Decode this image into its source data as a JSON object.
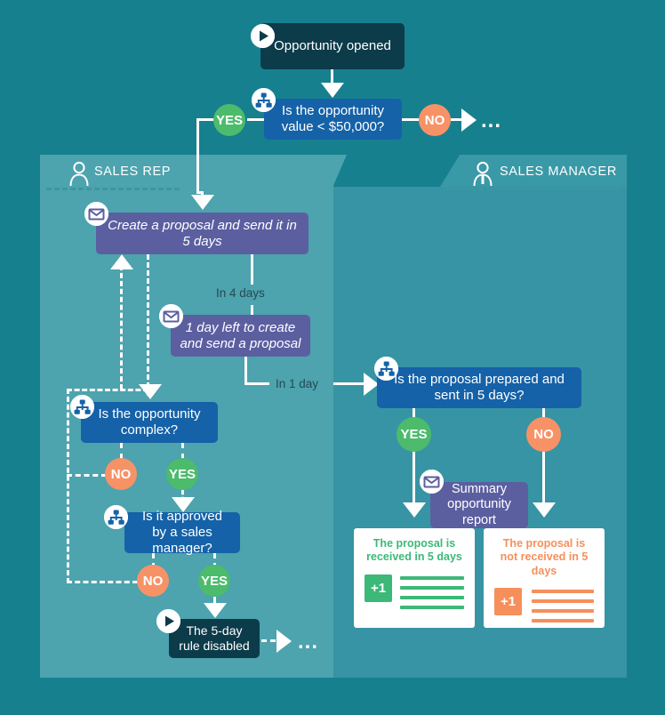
{
  "diagram": {
    "title_node": {
      "label": "Opportunity\nopened",
      "icon": "play-icon"
    },
    "lanes": [
      {
        "id": "sales-rep",
        "title": "SALES REP",
        "icon": "person-icon"
      },
      {
        "id": "sales-manager",
        "title": "SALES MANAGER",
        "icon": "person-icon"
      }
    ],
    "nodes": {
      "opportunity_opened": "Opportunity opened",
      "value_check": "Is the opportunity value < $50,000?",
      "create_proposal": "Create a proposal and send it in 5 days",
      "one_day_left": "1 day left to create and send a proposal",
      "opportunity_complex": "Is the opportunity complex?",
      "approved_by_manager": "Is it approved by a sales manager?",
      "rule_disabled": "The 5-day rule disabled",
      "proposal_prepared": "Is the proposal prepared and sent in 5 days?",
      "summary_report": "Summary opportunity report"
    },
    "branch_labels": {
      "yes": "YES",
      "no": "NO"
    },
    "time_labels": {
      "in_4_days": "In 4 days",
      "in_1_day": "In 1 day"
    },
    "ellipsis": "...",
    "result_cards": [
      {
        "title": "The proposal is received in 5 days",
        "counter": "+1",
        "color": "#3cb878",
        "bars": 4
      },
      {
        "title": "The proposal is not received in 5 days",
        "counter": "+1",
        "color": "#f68f5c",
        "bars": 4
      }
    ],
    "colors": {
      "background": "#17808f",
      "lane_rep": "#4da3ae",
      "lane_manager": "#3694a4",
      "node_dark": "#0c3b4a",
      "node_blue": "#1562a8",
      "node_purple": "#5b5fa0",
      "yes": "#4cbb6c",
      "no": "#f79267",
      "green_result": "#3cb878",
      "orange_result": "#f68f5c"
    },
    "icons": {
      "play": "play-icon",
      "branch": "branch-condition-icon",
      "mail": "mail-icon",
      "person": "person-icon"
    }
  }
}
